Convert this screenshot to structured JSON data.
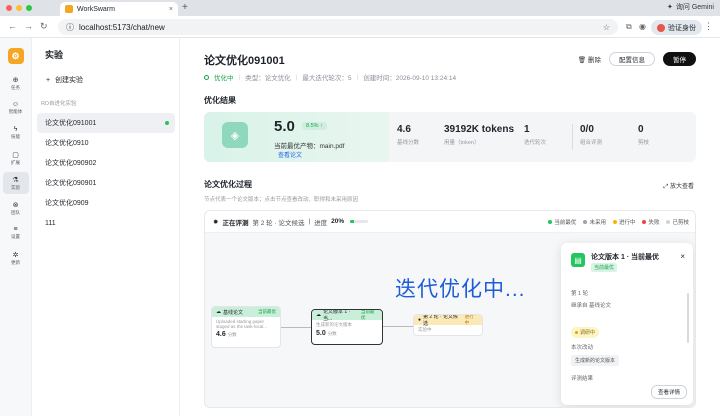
{
  "browser": {
    "tab_title": "WorkSwarm",
    "url": "localhost:5173/chat/new",
    "gemini_label": "询问 Gemini",
    "verify_label": "验证身份"
  },
  "rail": [
    {
      "label": "任务",
      "icon": "⊕"
    },
    {
      "label": "智能体",
      "icon": "☺"
    },
    {
      "label": "技能",
      "icon": "ϟ"
    },
    {
      "label": "扩展",
      "icon": "▢"
    },
    {
      "label": "实验",
      "icon": "⚗",
      "active": true
    },
    {
      "label": "团队",
      "icon": "⊗"
    },
    {
      "label": "设置",
      "icon": "≡"
    },
    {
      "label": "更新",
      "icon": "✲"
    }
  ],
  "sidebar": {
    "title": "实验",
    "new_label": "创建实验",
    "group_label": "RD自进化实验",
    "items": [
      {
        "label": "论文优化091001",
        "active": true
      },
      {
        "label": "论文优化0910"
      },
      {
        "label": "论文优化090902"
      },
      {
        "label": "论文优化090901"
      },
      {
        "label": "论文优化0909"
      },
      {
        "label": "111"
      }
    ]
  },
  "header": {
    "title": "论文优化091001",
    "status": "优化中",
    "type": "类型：论文优化",
    "max_iter": "最大迭代轮次：5",
    "created": "创建时间：2026-09-10 13:24:14",
    "delete_label": "删除",
    "config_label": "配置信息",
    "pause_label": "暂停"
  },
  "result": {
    "section": "优化结果",
    "score": "5.0",
    "pct": "8.5% ↑",
    "best_label": "当前最优产物：main.pdf",
    "view_label": "查看论文",
    "stats": [
      {
        "value": "4.6",
        "label": "基线分数"
      },
      {
        "value": "39192K tokens",
        "label": "用量（token）"
      },
      {
        "value": "1",
        "label": "迭代轮次"
      },
      {
        "value": "0/0",
        "label": "组合评测"
      },
      {
        "value": "0",
        "label": "剪枝"
      }
    ]
  },
  "process": {
    "title": "论文优化过程",
    "subtitle": "节点代表一个论文版本；点击节点查看改动、职得和未采用原因",
    "zoom_label": "放大查看",
    "status_label": "正在评测",
    "round_label": "第 2 轮 · 论文候选",
    "progress_label": "进度",
    "progress_pct": "20%",
    "progress_value": 0.2,
    "legend": [
      {
        "label": "当前最优",
        "color": "#22c55e"
      },
      {
        "label": "未采用",
        "color": "#9ca3af"
      },
      {
        "label": "进行中",
        "color": "#f5b700"
      },
      {
        "label": "失败",
        "color": "#ef4444"
      },
      {
        "label": "已剪枝",
        "color": "#d1d5db"
      }
    ],
    "overlay_text": "迭代优化中...",
    "nodes": [
      {
        "title": "基线论文",
        "tag": "当前最优",
        "desc": "Uploaded starting paper staged as the task-local...",
        "score": "4.6",
        "unit": "分数"
      },
      {
        "title": "论文版本 1 · 当...",
        "tag": "当前最优",
        "desc": "生成新的论文版本",
        "score": "5.0",
        "unit": "分数"
      },
      {
        "title": "第 2 轮 · 论文候选",
        "tag": "进行中",
        "desc": "实验中"
      }
    ]
  },
  "detail": {
    "title": "论文版本 1 · 当前最优",
    "badge": "当前最优",
    "round": "第 1 轮",
    "parent": "继承自 基线论文",
    "chip": "调研中",
    "changes_label": "本次改动",
    "change_value": "生成新的论文版本",
    "review_label": "评测结果",
    "view_btn": "查看详情"
  }
}
